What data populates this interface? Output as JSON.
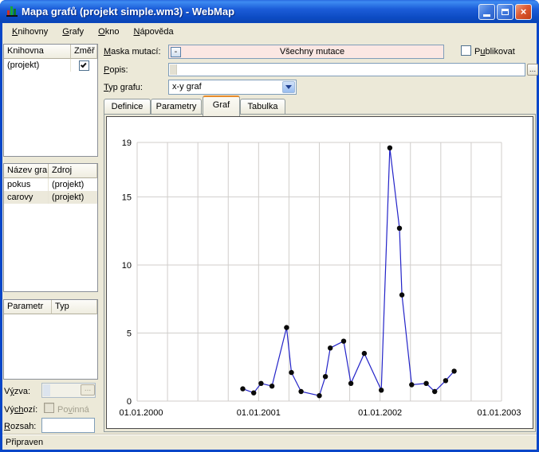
{
  "window": {
    "title": "Mapa grafů (projekt simple.wm3) - WebMap"
  },
  "menu": {
    "items": [
      {
        "text": "Knihovny",
        "accel": "K"
      },
      {
        "text": "Grafy",
        "accel": "G"
      },
      {
        "text": "Okno",
        "accel": "O"
      },
      {
        "text": "Nápověda",
        "accel": "N"
      }
    ]
  },
  "sidebar": {
    "libraries": {
      "headers": [
        "Knihovna",
        "Změř"
      ],
      "rows": [
        {
          "name": "(projekt)",
          "checked": true
        }
      ]
    },
    "graphs": {
      "headers": [
        "Název gra",
        "Zdroj"
      ],
      "rows": [
        {
          "name": "pokus",
          "source": "(projekt)",
          "selected": false
        },
        {
          "name": "carovy",
          "source": "(projekt)",
          "selected": true
        }
      ]
    },
    "parameters": {
      "headers": [
        "Parametr",
        "Typ"
      ],
      "rows": []
    },
    "vyzva": {
      "label": {
        "text": "Výzva:",
        "accel": "ý"
      },
      "value": "",
      "more_label": "...",
      "disabled": true
    },
    "vychozi": {
      "label": {
        "text": "Výchozí:",
        "accel": "ch"
      },
      "povinna": {
        "text": "Povinná",
        "accel": "v"
      },
      "checked": false,
      "disabled": true
    },
    "rozsah": {
      "label": {
        "text": "Rozsah:",
        "accel": "R"
      },
      "value": ""
    }
  },
  "form": {
    "maska": {
      "label": {
        "text": "Maska mutací:",
        "accel": "M"
      },
      "value": "Všechny mutace",
      "minus_label": "-"
    },
    "publikovat": {
      "label": {
        "text": "Publikovat",
        "accel": "u"
      },
      "checked": false
    },
    "popis": {
      "label": {
        "text": "Popis:",
        "accel": "P"
      },
      "value": "",
      "more_label": "..."
    },
    "typ_grafu": {
      "label": {
        "text": "Typ grafu:",
        "accel": "T"
      },
      "value": "x-y graf"
    }
  },
  "tabs": [
    {
      "label": "Definice",
      "active": false
    },
    {
      "label": "Parametry",
      "active": false
    },
    {
      "label": "Graf",
      "active": true
    },
    {
      "label": "Tabulka",
      "active": false
    }
  ],
  "status": {
    "text": "Připraven"
  },
  "colors": {
    "mask_field_bg": "#FBE7E3",
    "active_tab_accent": "#E68B2C",
    "line": "#2323C8",
    "marker": "#0A0A0A",
    "grid": "#D0CECB"
  },
  "chart_data": {
    "type": "line",
    "title": "",
    "xlabel": "",
    "ylabel": "",
    "grid": true,
    "legend": false,
    "x_range": [
      2000,
      2003
    ],
    "y_range": [
      0,
      19
    ],
    "y_ticks": [
      0,
      5,
      10,
      15,
      19
    ],
    "x_minor_step": 0.25,
    "x_ticks": [
      {
        "value": 2000,
        "label": "01.01.2000"
      },
      {
        "value": 2001,
        "label": "01.01.2001"
      },
      {
        "value": 2002,
        "label": "01.01.2002"
      },
      {
        "value": 2003,
        "label": "01.01.2003"
      }
    ],
    "x": [
      2000.87,
      2000.96,
      2001.02,
      2001.11,
      2001.23,
      2001.27,
      2001.35,
      2001.5,
      2001.55,
      2001.59,
      2001.7,
      2001.76,
      2001.87,
      2002.01,
      2002.08,
      2002.16,
      2002.18,
      2002.26,
      2002.38,
      2002.45,
      2002.54,
      2002.61
    ],
    "y": [
      0.9,
      0.6,
      1.3,
      1.1,
      5.4,
      2.1,
      0.7,
      0.4,
      1.8,
      3.9,
      4.4,
      1.3,
      3.5,
      0.8,
      18.6,
      12.7,
      7.8,
      1.2,
      1.3,
      0.7,
      1.5,
      2.2
    ]
  }
}
